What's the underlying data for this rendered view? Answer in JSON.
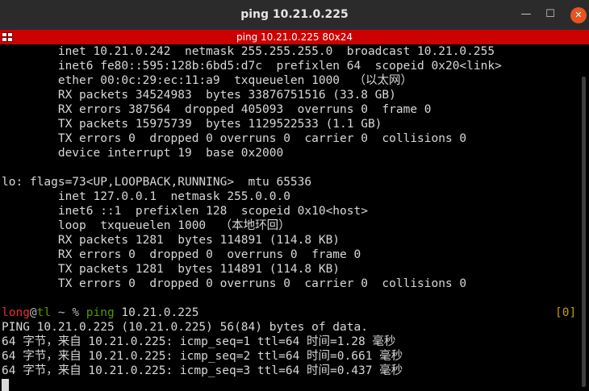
{
  "window": {
    "title": "ping 10.21.0.225",
    "subtitle": "ping 10.21.0.225 80x24",
    "minimize_glyph": "—",
    "maximize_glyph": "☐",
    "close_glyph": "✕",
    "icons": {
      "menu": "terminal-menu-icon",
      "minimize": "minimize-icon",
      "maximize": "maximize-icon",
      "close": "close-icon"
    },
    "colors": {
      "titlebar": "#2b2b2b",
      "subbar": "#cc0000",
      "close": "#e95420",
      "background": "#000000"
    }
  },
  "terminal": {
    "output_lines": [
      "        inet 10.21.0.242  netmask 255.255.255.0  broadcast 10.21.0.255",
      "        inet6 fe80::595:128b:6bd5:d7c  prefixlen 64  scopeid 0x20<link>",
      "        ether 00:0c:29:ec:11:a9  txqueuelen 1000  （以太网）",
      "        RX packets 34524983  bytes 33876751516 (33.8 GB)",
      "        RX errors 387564  dropped 405093  overruns 0  frame 0",
      "        TX packets 15975739  bytes 1129522533 (1.1 GB)",
      "        TX errors 0  dropped 0 overruns 0  carrier 0  collisions 0",
      "        device interrupt 19  base 0x2000",
      "",
      "lo: flags=73<UP,LOOPBACK,RUNNING>  mtu 65536",
      "        inet 127.0.0.1  netmask 255.0.0.0",
      "        inet6 ::1  prefixlen 128  scopeid 0x10<host>",
      "        loop  txqueuelen 1000  （本地环回）",
      "        RX packets 1281  bytes 114891 (114.8 KB)",
      "        RX errors 0  dropped 0  overruns 0  frame 0",
      "        TX packets 1281  bytes 114891 (114.8 KB)",
      "        TX errors 0  dropped 0 overruns 0  carrier 0  collisions 0",
      ""
    ],
    "prompt": {
      "user": "long",
      "at": "@",
      "host": "tl",
      "path": " ~ % ",
      "command_name": "ping",
      "command_args": " 10.21.0.225",
      "job_indicator": "[0]"
    },
    "ping_output": [
      "PING 10.21.0.225 (10.21.0.225) 56(84) bytes of data.",
      "64 字节，来自 10.21.0.225: icmp_seq=1 ttl=64 时间=1.28 毫秒",
      "64 字节，来自 10.21.0.225: icmp_seq=2 ttl=64 时间=0.661 毫秒",
      "64 字节，来自 10.21.0.225: icmp_seq=3 ttl=64 时间=0.437 毫秒"
    ]
  }
}
